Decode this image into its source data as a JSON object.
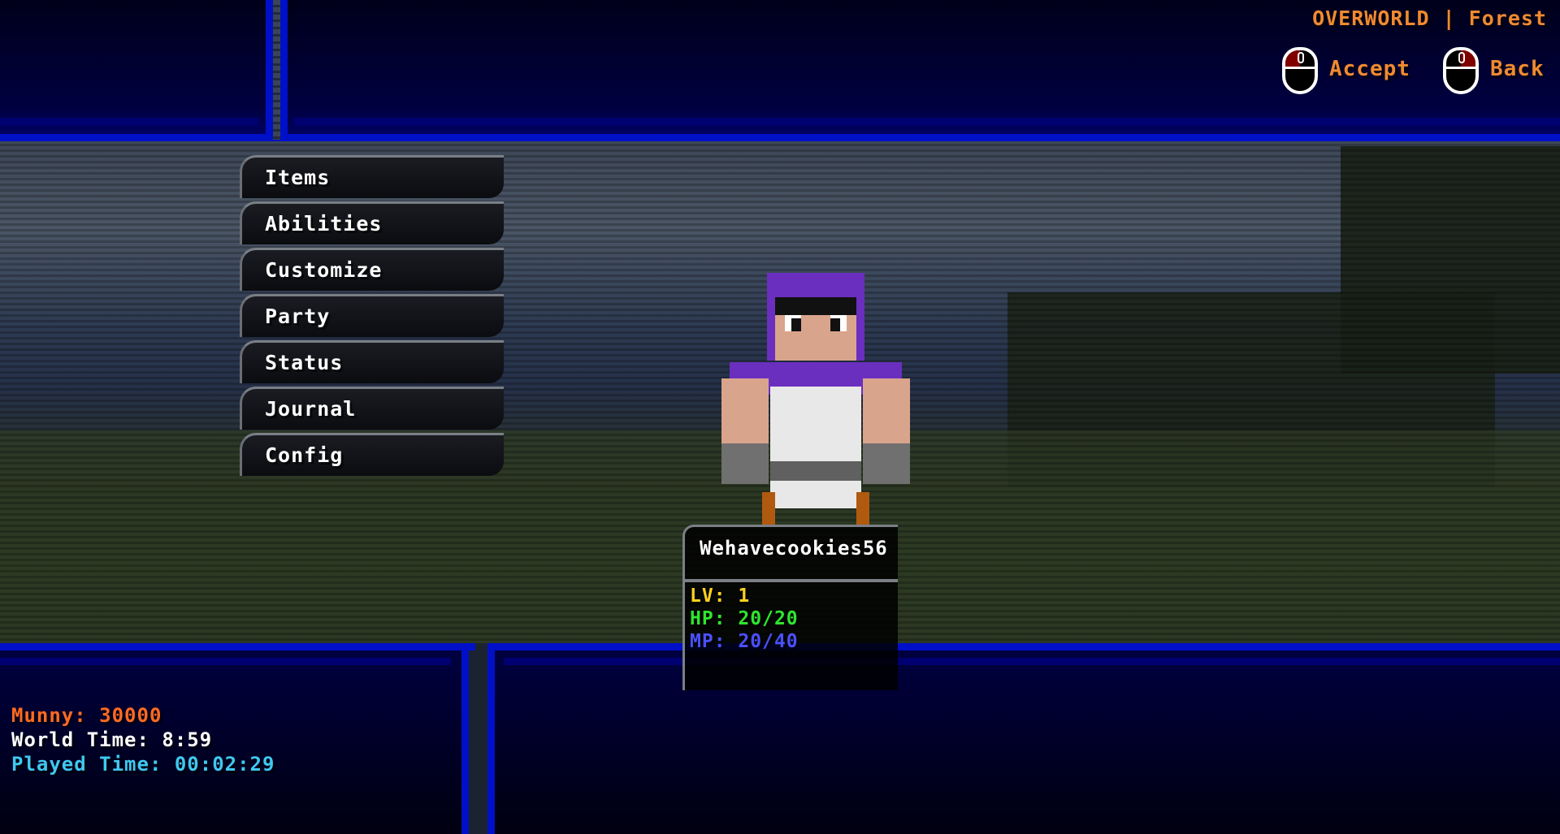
{
  "location": "OVERWORLD | Forest",
  "controls": {
    "accept": "Accept",
    "back": "Back"
  },
  "menu": [
    "Items",
    "Abilities",
    "Customize",
    "Party",
    "Status",
    "Journal",
    "Config"
  ],
  "player": {
    "name": "Wehavecookies56",
    "lv_label": "LV:",
    "lv": "1",
    "hp_label": "HP:",
    "hp": "20/20",
    "mp_label": "MP:",
    "mp": "20/40"
  },
  "info": {
    "munny_label": "Munny:",
    "munny": "30000",
    "world_time_label": "World Time:",
    "world_time": "8:59",
    "played_time_label": "Played Time:",
    "played_time": "00:02:29"
  },
  "colors": {
    "orange": "#f08a30",
    "munny": "#ff6a20",
    "lv": "#ffd21e",
    "hp": "#2ee62e",
    "mp": "#4a50ff",
    "played": "#40c8f0",
    "border": "#0010c8"
  }
}
